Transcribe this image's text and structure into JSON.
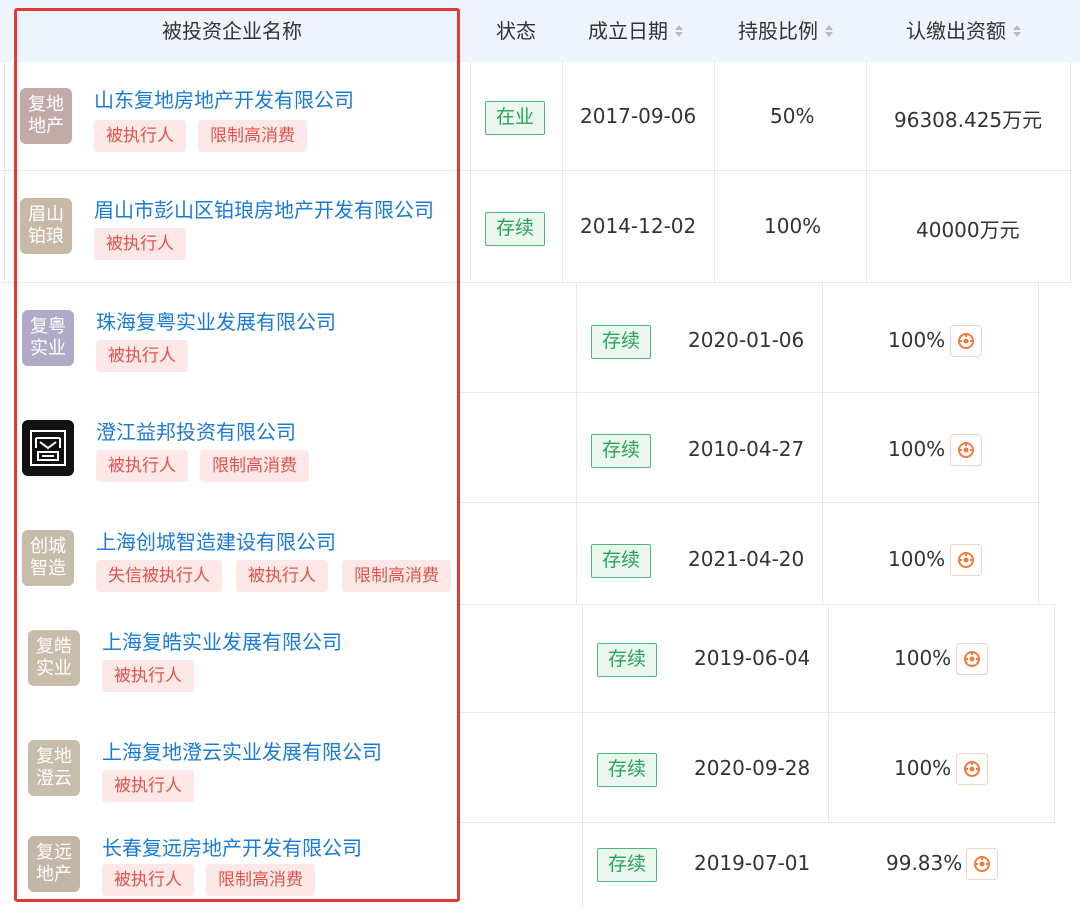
{
  "header": {
    "company_name": "被投资企业名称",
    "status": "状态",
    "founded": "成立日期",
    "ratio": "持股比例",
    "capital": "认缴出资额"
  },
  "rows": [
    {
      "logo": "复地\n地产",
      "logo_color": "#c2aba6",
      "name": "山东复地房地产开发有限公司",
      "tags": [
        "被执行人",
        "限制高消费"
      ],
      "status": "在业",
      "date": "2017-09-06",
      "ratio": "50%",
      "capital": "96308.425万元"
    },
    {
      "logo": "眉山\n铂琅",
      "logo_color": "#c7b9a6",
      "name": "眉山市彭山区铂琅房地产开发有限公司",
      "tags": [
        "被执行人"
      ],
      "status": "存续",
      "date": "2014-12-02",
      "ratio": "100%",
      "capital": "40000万元"
    },
    {
      "logo": "复粤\n实业",
      "logo_color": "#b0aac8",
      "name": "珠海复粤实业发展有限公司",
      "tags": [
        "被执行人"
      ],
      "status": "存续",
      "date": "2020-01-06",
      "ratio": "100%"
    },
    {
      "logo": "",
      "logo_color": "#111111",
      "name": "澄江益邦投资有限公司",
      "tags": [
        "被执行人",
        "限制高消费"
      ],
      "status": "存续",
      "date": "2010-04-27",
      "ratio": "100%"
    },
    {
      "logo": "创城\n智造",
      "logo_color": "#c7bba9",
      "name": "上海创城智造建设有限公司",
      "tags": [
        "失信被执行人",
        "被执行人",
        "限制高消费"
      ],
      "status": "存续",
      "date": "2021-04-20",
      "ratio": "100%"
    },
    {
      "logo": "复皓\n实业",
      "logo_color": "#c8bcab",
      "name": "上海复皓实业发展有限公司",
      "tags": [
        "被执行人"
      ],
      "status": "存续",
      "date": "2019-06-04",
      "ratio": "100%"
    },
    {
      "logo": "复地\n澄云",
      "logo_color": "#c6bdaa",
      "name": "上海复地澄云实业发展有限公司",
      "tags": [
        "被执行人"
      ],
      "status": "存续",
      "date": "2020-09-28",
      "ratio": "100%"
    },
    {
      "logo": "复远\n地产",
      "logo_color": "#c4b6a6",
      "name": "长春复远房地产开发有限公司",
      "tags": [
        "被执行人",
        "限制高消费"
      ],
      "status": "存续",
      "date": "2019-07-01",
      "ratio": "99.83%"
    }
  ],
  "colors": {
    "link": "#1a7bd4",
    "tag_bg": "#fde8e8",
    "tag_text": "#e0534a",
    "status_green": "#2aa35a",
    "highlight_frame": "#e53935"
  },
  "icons": {
    "equity_track": "equity-penetration-icon"
  }
}
